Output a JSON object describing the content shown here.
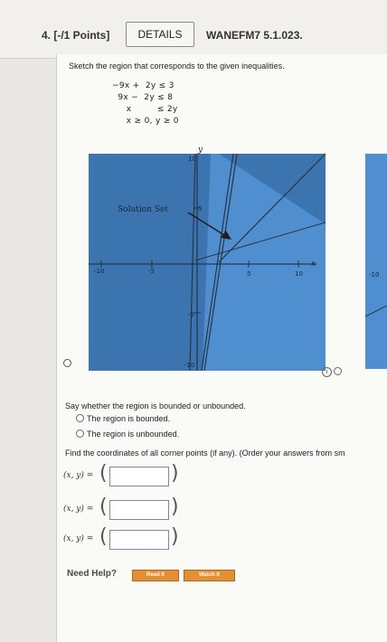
{
  "header": {
    "question_number": "4. [-/1 Points]",
    "details_label": "DETAILS",
    "question_code": "WANEFM7 5.1.023."
  },
  "prompt": "Sketch the region that corresponds to the given inequalities.",
  "inequalities": [
    "−9x +  2y ≤ 3",
    "  9x −  2y ≤ 8",
    "     x         ≤ 2y",
    "     x ≥ 0, y ≥ 0"
  ],
  "graph": {
    "x_axis_label": "x",
    "y_axis_label": "y",
    "solution_label": "Solution Set",
    "tick_labels": {
      "y_top": "10",
      "y_five": "5",
      "y_neg_five": "-5",
      "y_bottom": "-10",
      "x_left": "-10",
      "x_neg_five": "-5",
      "x_five": "5",
      "x_right": "10"
    },
    "colors": {
      "dark_region": "#3c74b0",
      "light_region": "#4f8fd0",
      "boundary_line": "#2a3440",
      "arrow": "#1f1f1f"
    }
  },
  "graph_partial_label": "-10",
  "info_icon": "i",
  "bounded_question": "Say whether the region is bounded or unbounded.",
  "options": [
    "The region is bounded.",
    "The region is unbounded."
  ],
  "corner_points_instruction": "Find the coordinates of all corner points (if any). (Order your answers from sm",
  "corner_points": [
    {
      "label": "(x, y) =",
      "value": ""
    },
    {
      "label": "(x, y) =",
      "value": ""
    },
    {
      "label": "(x, y) =",
      "value": ""
    }
  ],
  "help": {
    "need_help": "Need Help?",
    "read_it": "Read It",
    "watch_it": "Watch It"
  }
}
